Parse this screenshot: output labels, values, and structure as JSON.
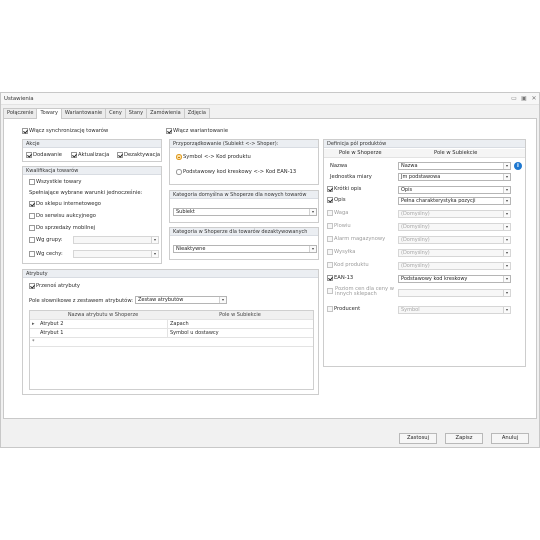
{
  "window": {
    "title": "Ustawienia",
    "minimize": "▭",
    "restore": "▣",
    "close": "✕"
  },
  "tabs": [
    "Połączenie",
    "Towary",
    "Wariantowanie",
    "Ceny",
    "Stany",
    "Zamówienia",
    "Zdjęcia"
  ],
  "active_tab": "Towary",
  "sync_products": {
    "label": "Włącz synchronizację towarów",
    "checked": true
  },
  "variants": {
    "label": "Włącz wariantowanie",
    "checked": true
  },
  "actions": {
    "title": "Akcje",
    "add": {
      "label": "Dodawanie",
      "checked": true
    },
    "update": {
      "label": "Aktualizacja",
      "checked": true
    },
    "deactivate": {
      "label": "Dezaktywacja",
      "checked": true
    }
  },
  "qualification": {
    "title": "Kwalifikacja towarów",
    "all": {
      "label": "Wszystkie towary",
      "checked": false
    },
    "hint": "Spełniające wybrane warunki jednocześnie:",
    "shop": {
      "label": "Do sklepu internetowego",
      "checked": true
    },
    "auction": {
      "label": "Do serwisu aukcyjnego",
      "checked": false
    },
    "mobile": {
      "label": "Do sprzedaży mobilnej",
      "checked": false
    },
    "groups": {
      "label": "Wg grupy:",
      "checked": false
    },
    "features": {
      "label": "Wg cechy:",
      "checked": false
    }
  },
  "assignment": {
    "title": "Przyporządkowanie (Subiekt <-> Shoper):",
    "symbol": {
      "label": "Symbol <-> Kod produktu",
      "selected": true
    },
    "barcode": {
      "label": "Podstawowy kod kreskowy <-> Kod EAN-13",
      "selected": false
    }
  },
  "default_category": {
    "title": "Kategoria domyślna w Shoperze dla nowych towarów",
    "value": "Subiekt"
  },
  "deactivated_category": {
    "title": "Kategoria w Shoperze dla towarów dezaktywowanych",
    "value": "Nieaktywne"
  },
  "field_definition": {
    "title": "Definicja pól produktów",
    "col_shoper": "Pole w Shoperze",
    "col_subiekt": "Pole w Subiekcie",
    "rows": [
      {
        "label": "Nazwa",
        "checkbox": false,
        "checked": false,
        "enabled": true,
        "value": "Nazwa",
        "info": true
      },
      {
        "label": "Jednostka miary",
        "checkbox": false,
        "checked": false,
        "enabled": true,
        "value": "Jm podstawowa"
      },
      {
        "label": "Krótki opis",
        "checkbox": true,
        "checked": true,
        "enabled": true,
        "value": "Opis"
      },
      {
        "label": "Opis",
        "checkbox": true,
        "checked": true,
        "enabled": true,
        "value": "Pełna charakterystyka pozycji"
      },
      {
        "label": "Waga",
        "checkbox": true,
        "checked": false,
        "enabled": false,
        "value": "(Domyślny)"
      },
      {
        "label": "Plowiu",
        "checkbox": true,
        "checked": false,
        "enabled": false,
        "value": "(Domyślny)"
      },
      {
        "label": "Alarm magazynowy",
        "checkbox": true,
        "checked": false,
        "enabled": false,
        "value": "(Domyślny)"
      },
      {
        "label": "Wysyłka",
        "checkbox": true,
        "checked": false,
        "enabled": false,
        "value": "(Domyślny)"
      },
      {
        "label": "Kod produktu",
        "checkbox": true,
        "checked": false,
        "enabled": false,
        "value": "(Domyślny)"
      },
      {
        "label": "EAN-13",
        "checkbox": true,
        "checked": true,
        "enabled": true,
        "value": "Podstawowy kod kreskowy"
      },
      {
        "label": "Poziom cen dla ceny w innych sklepach",
        "checkbox": true,
        "checked": false,
        "enabled": false,
        "value": ""
      },
      {
        "label": "Producent",
        "checkbox": true,
        "checked": false,
        "enabled": false,
        "value": "Symbol"
      }
    ]
  },
  "attributes": {
    "title": "Atrybuty",
    "transfer": {
      "label": "Przenoś atrybuty",
      "checked": true
    },
    "dict_label": "Pole słownikowe z zestawem atrybutów:",
    "dict_value": "Zestaw atrybutów",
    "col_shoper": "Nazwa atrybutu w Shoperze",
    "col_subiekt": "Pole w Subiekcie",
    "rows": [
      {
        "indicator": "▸",
        "shoper": "Atrybut 2",
        "subiekt": "Zapach"
      },
      {
        "indicator": "",
        "shoper": "Atrybut 1",
        "subiekt": "Symbol u dostawcy"
      },
      {
        "indicator": "*",
        "shoper": "",
        "subiekt": ""
      }
    ]
  },
  "buttons": {
    "apply": "Zastosuj",
    "save": "Zapisz",
    "cancel": "Anuluj"
  }
}
